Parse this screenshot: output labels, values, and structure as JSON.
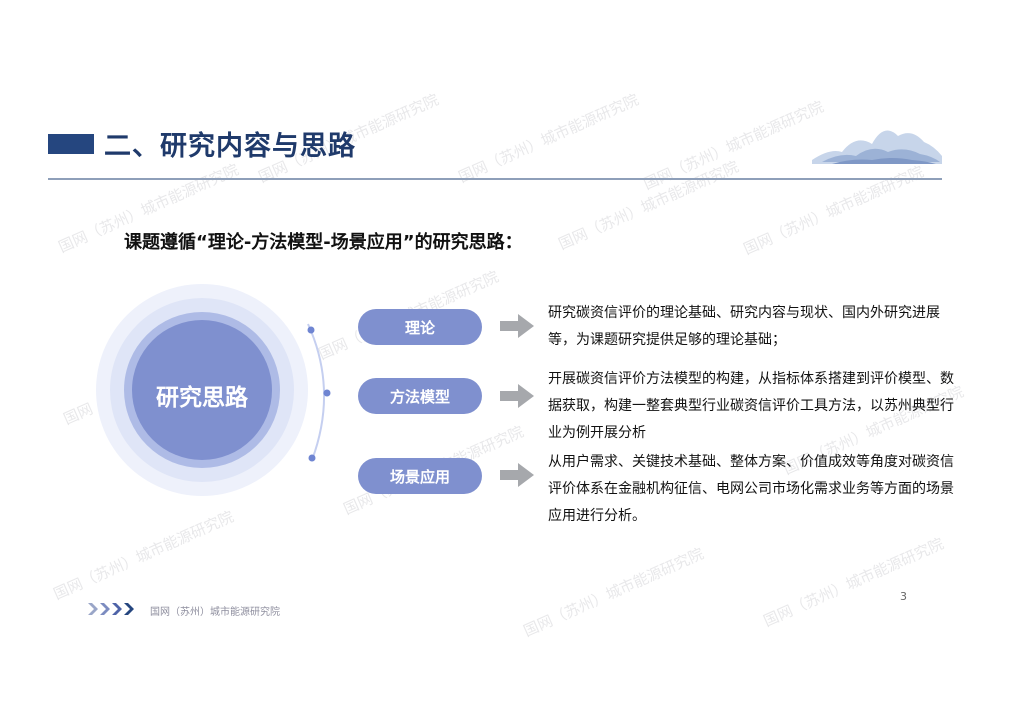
{
  "slide": {
    "title": "二、研究内容与思路",
    "subtitle": "课题遵循“理论-方法模型-场景应用”的研究思路：",
    "center_label": "研究思路",
    "steps": [
      {
        "label": "理论",
        "description": "研究碳资信评价的理论基础、研究内容与现状、国内外研究进展等，为课题研究提供足够的理论基础；"
      },
      {
        "label": "方法模型",
        "description": "开展碳资信评价方法模型的构建，从指标体系搭建到评价模型、数据获取，构建一整套典型行业碳资信评价工具方法，以苏州典型行业为例开展分析"
      },
      {
        "label": "场景应用",
        "description": "从用户需求、关键技术基础、整体方案、价值成效等角度对碳资信评价体系在金融机构征信、电网公司市场化需求业务等方面的场景应用进行分析。"
      }
    ],
    "footer_org": "国网（苏州）城市能源研究院",
    "page_number": "3",
    "watermark_text": "国网（苏州）城市能源研究院"
  },
  "colors": {
    "title": "#1f3a6b",
    "accent_bar": "#25467f",
    "pill": "#7f90cf",
    "circle_core": "#7f90cf",
    "arrow": "#a6a8ac"
  },
  "icons": [
    "mountain-decoration",
    "arrow-right-icon",
    "chevron-right-icon"
  ]
}
